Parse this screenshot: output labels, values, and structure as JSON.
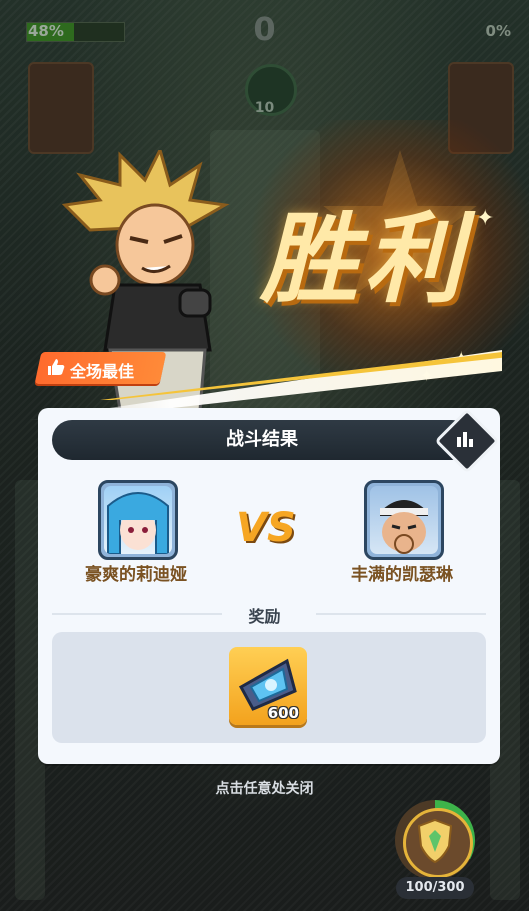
{
  "hud": {
    "left_percent": "48%",
    "left_fill": 0.48,
    "right_percent": "0%",
    "score": "0",
    "timer": "10"
  },
  "victory": {
    "title": "胜利",
    "badge": "全场最佳"
  },
  "result": {
    "title": "战斗结果",
    "player1": "豪爽的莉迪娅",
    "vs_text": "VS",
    "player2": "丰满的凯瑟琳",
    "reward_label": "奖励",
    "reward_count": "600",
    "close_hint": "点击任意处关闭"
  },
  "rank": {
    "progress": "100/300",
    "fill": 0.33
  },
  "colors": {
    "panel": "#f4f8fd",
    "accent_gold": "#f6a623",
    "name_brown": "#7a5222",
    "badge_orange": "#ff6b2e"
  },
  "icons": [
    "thumb-up-icon",
    "bar-chart-icon",
    "gem-icon",
    "shield-icon"
  ]
}
